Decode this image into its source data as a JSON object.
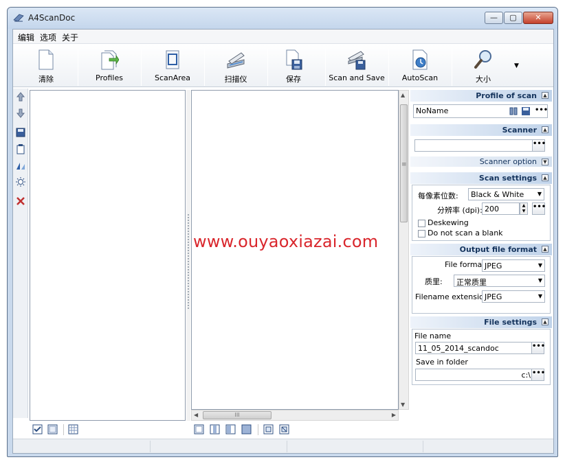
{
  "window": {
    "title": "A4ScanDoc",
    "minimize": "—",
    "maximize": "▢",
    "close": "✕"
  },
  "menu": [
    "编辑",
    "选项",
    "关于"
  ],
  "toolbar": {
    "clear": "清除",
    "profiles": "Profiles",
    "scanarea": "ScanArea",
    "scanner": "扫描仪",
    "save": "保存",
    "scan_and_save": "Scan and Save",
    "autoscan": "AutoScan",
    "size": "大小",
    "more": "▼"
  },
  "panel": {
    "profile": {
      "header": "Profile of scan",
      "value": "NoName"
    },
    "scanner": {
      "header": "Scanner",
      "value": "",
      "option_header": "Scanner option"
    },
    "scan_settings": {
      "header": "Scan settings",
      "bits_label": "每像素位数:",
      "bits_value": "Black & White",
      "dpi_label": "分辨率 (dpi):",
      "dpi_value": "200",
      "deskewing": "Deskewing",
      "skip_blank": "Do not scan a blank"
    },
    "output": {
      "header": "Output file format",
      "format_label": "File format",
      "format_value": "JPEG",
      "quality_label": "质里:",
      "quality_value": "正常质里",
      "ext_label": "Filename extension:",
      "ext_value": "JPEG"
    },
    "file": {
      "header": "File settings",
      "name_label": "File name",
      "name_value": "11_05_2014_scandoc",
      "folder_label": "Save in  folder",
      "folder_value": "c:\\"
    },
    "ellipsis": "•••",
    "toggle": "▲",
    "toggle_down": "▼"
  },
  "scroll": {
    "grip": "≡",
    "hgrip": "III",
    "up": "▲",
    "down": "▼",
    "left": "◀",
    "right": "▶"
  },
  "watermark": "www.ouyaoxiazai.com",
  "colors": {
    "accent": "#14335c",
    "watermark": "#d9262c",
    "titlebar": "#c4d6ec"
  }
}
